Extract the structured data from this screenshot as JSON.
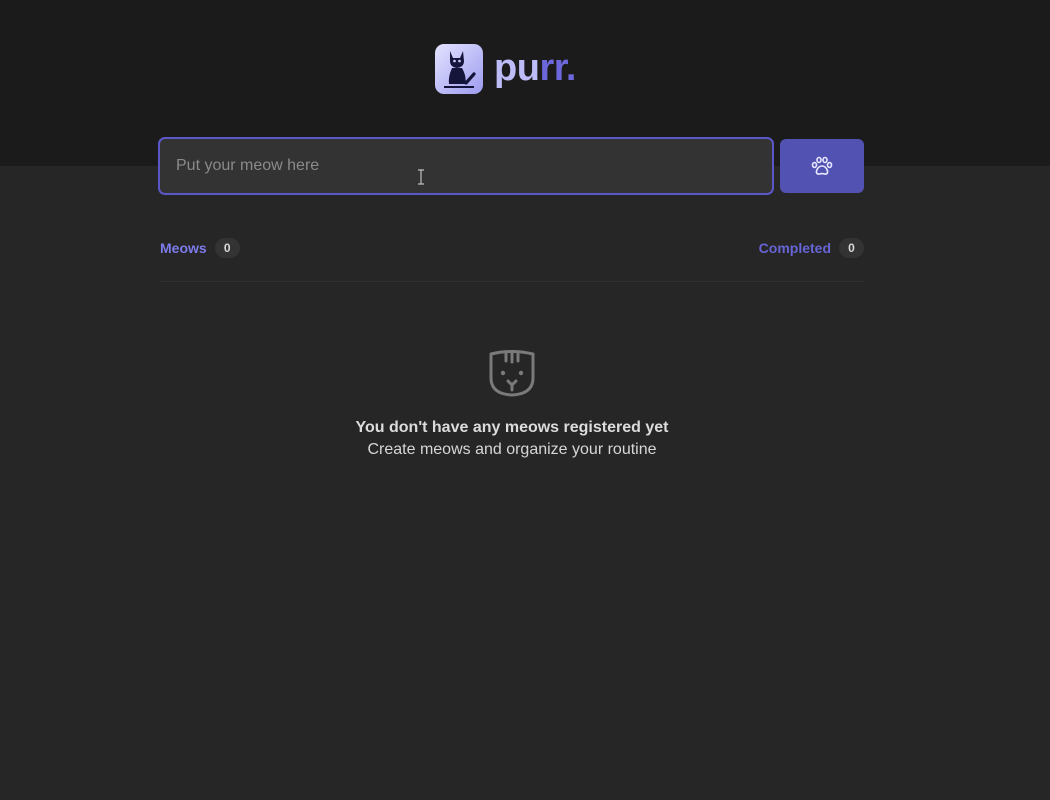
{
  "app": {
    "logo_text_a": "pu",
    "logo_text_b": "rr.",
    "icon": "cat-check-icon"
  },
  "form": {
    "placeholder": "Put your meow here",
    "value": "",
    "add_button_icon": "paw-icon"
  },
  "counters": {
    "meows_label": "Meows",
    "meows_count": "0",
    "completed_label": "Completed",
    "completed_count": "0"
  },
  "empty_state": {
    "icon": "cat-face-icon",
    "title": "You don't have any meows registered yet",
    "subtitle": "Create meows and organize your routine"
  },
  "colors": {
    "accent": "#5b57c9",
    "button": "#5252b2",
    "background": "#262626",
    "header": "#1b1b1b"
  }
}
